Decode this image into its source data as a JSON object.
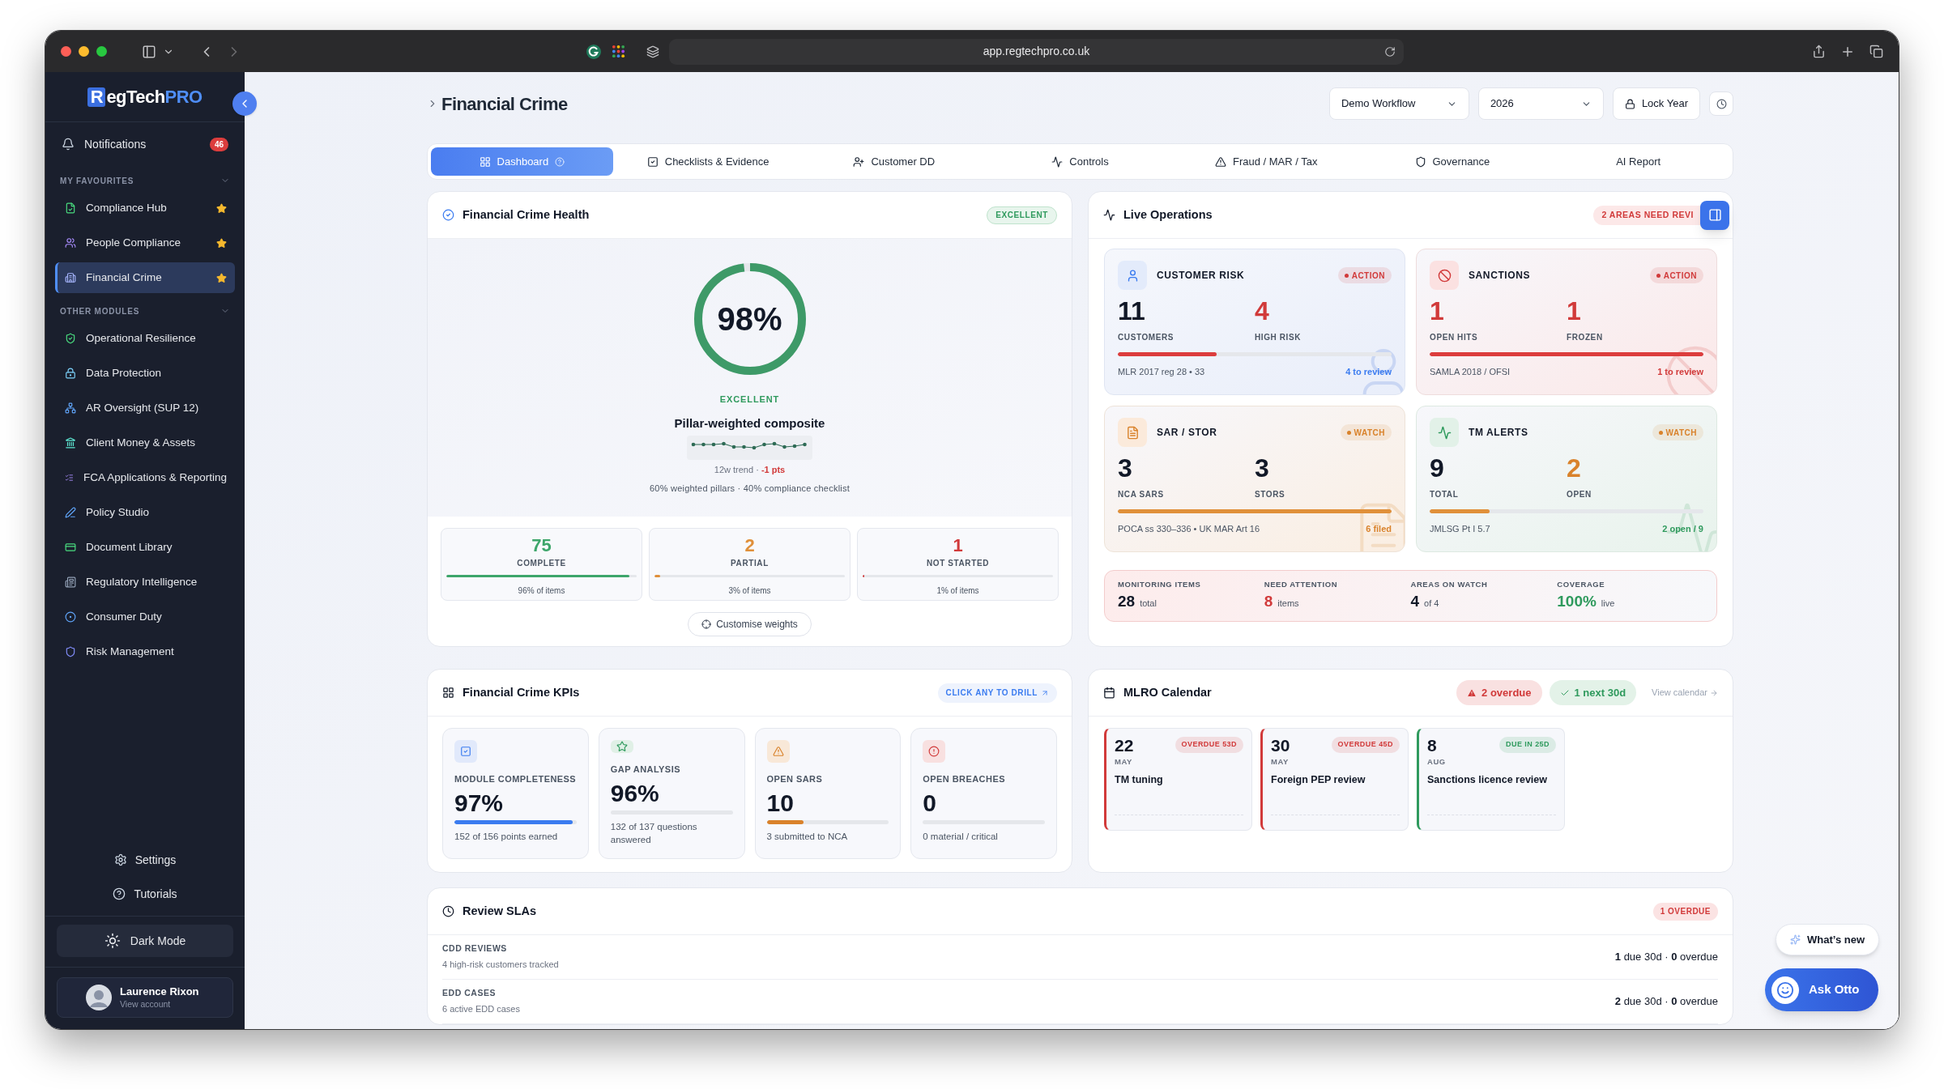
{
  "browser": {
    "url": "app.regtechpro.co.uk"
  },
  "brand": {
    "mark": "R",
    "name": "egTech",
    "accent": "PRO"
  },
  "sidebar": {
    "notifications": {
      "label": "Notifications",
      "count": "46"
    },
    "sections": [
      {
        "title": "MY FAVOURITES",
        "expanded": true,
        "items": [
          {
            "label": "Compliance Hub",
            "selected": false,
            "starred": true
          },
          {
            "label": "People Compliance",
            "selected": false,
            "starred": true
          },
          {
            "label": "Financial Crime",
            "selected": true,
            "starred": true
          }
        ]
      },
      {
        "title": "OTHER MODULES",
        "expanded": true,
        "items": [
          {
            "label": "Operational Resilience",
            "selected": false
          },
          {
            "label": "Data Protection",
            "selected": false
          },
          {
            "label": "AR Oversight (SUP 12)",
            "selected": false
          },
          {
            "label": "Client Money & Assets",
            "selected": false
          },
          {
            "label": "FCA Applications & Reporting",
            "selected": false
          },
          {
            "label": "Policy Studio",
            "selected": false
          },
          {
            "label": "Document Library",
            "selected": false
          },
          {
            "label": "Regulatory Intelligence",
            "selected": false
          },
          {
            "label": "Consumer Duty",
            "selected": false
          },
          {
            "label": "Risk Management",
            "selected": false
          }
        ]
      }
    ],
    "links": [
      {
        "label": "Settings"
      },
      {
        "label": "Tutorials"
      }
    ],
    "dark_mode": "Dark Mode",
    "account": {
      "name": "Laurence Rixon",
      "subtitle": "View account"
    }
  },
  "header": {
    "title": "Financial Crime",
    "workflow": "Demo Workflow",
    "year": "2026",
    "lock": "Lock Year"
  },
  "tabs": [
    {
      "label": "Dashboard",
      "selected": true
    },
    {
      "label": "Checklists & Evidence",
      "selected": false
    },
    {
      "label": "Customer DD",
      "selected": false
    },
    {
      "label": "Controls",
      "selected": false
    },
    {
      "label": "Fraud / MAR / Tax",
      "selected": false
    },
    {
      "label": "Governance",
      "selected": false
    },
    {
      "label": "AI Report",
      "selected": false
    }
  ],
  "health": {
    "title": "Financial Crime Health",
    "badge": "EXCELLENT",
    "score": "98%",
    "level": 0.98,
    "status": "EXCELLENT",
    "subtitle": "Pillar-weighted composite",
    "trend_label": "12w trend ·",
    "trend_delta": "-1 pts",
    "note": "60% weighted pillars · 40% compliance checklist",
    "stats": [
      {
        "value": "75",
        "label": "COMPLETE",
        "level": 0.96,
        "color": "#3ea66b",
        "caption": "96% of items"
      },
      {
        "value": "2",
        "label": "PARTIAL",
        "level": 0.03,
        "color": "#e0903a",
        "caption": "3% of items"
      },
      {
        "value": "1",
        "label": "NOT STARTED",
        "level": 0.01,
        "color": "#d13a3a",
        "caption": "1% of items"
      }
    ],
    "button": "Customise weights"
  },
  "live_operations": {
    "title": "Live Operations",
    "badge": "2 AREAS NEED REVI",
    "cards": [
      {
        "title": "CUSTOMER RISK",
        "status": {
          "label": "ACTION",
          "color": "#d13a3a"
        },
        "metrics": [
          {
            "value": "11",
            "label": "CUSTOMERS",
            "color": "#111827"
          },
          {
            "value": "4",
            "label": "HIGH RISK",
            "color": "#d13a3a"
          }
        ],
        "bar": {
          "level": 0.36,
          "color": "#dc3d3d"
        },
        "reference": "MLR 2017 reg 28 • 33",
        "link": {
          "label": "4 to review",
          "color": "#3b7cf0"
        }
      },
      {
        "title": "SANCTIONS",
        "status": {
          "label": "ACTION",
          "color": "#d13a3a"
        },
        "metrics": [
          {
            "value": "1",
            "label": "OPEN HITS",
            "color": "#d13a3a"
          },
          {
            "value": "1",
            "label": "FROZEN",
            "color": "#d13a3a"
          }
        ],
        "bar": {
          "level": 1,
          "color": "#dc3d3d"
        },
        "reference": "SAMLA 2018 / OFSI",
        "link": {
          "label": "1 to review",
          "color": "#d13a3a"
        }
      },
      {
        "title": "SAR / STOR",
        "status": {
          "label": "WATCH",
          "color": "#d9822b"
        },
        "metrics": [
          {
            "value": "3",
            "label": "NCA SARS",
            "color": "#111827"
          },
          {
            "value": "3",
            "label": "STORS",
            "color": "#111827"
          }
        ],
        "bar": {
          "level": 1,
          "color": "#e0903a"
        },
        "reference": "POCA ss 330–336 • UK MAR Art 16",
        "link": {
          "label": "6 filed",
          "color": "#d9822b"
        }
      },
      {
        "title": "TM ALERTS",
        "status": {
          "label": "WATCH",
          "color": "#d9822b"
        },
        "metrics": [
          {
            "value": "9",
            "label": "TOTAL",
            "color": "#111827"
          },
          {
            "value": "2",
            "label": "OPEN",
            "color": "#d9822b"
          }
        ],
        "bar": {
          "level": 0.22,
          "color": "#e0903a"
        },
        "reference": "JMLSG Pt I 5.7",
        "link": {
          "label": "2 open / 9",
          "color": "#2f9a5d"
        }
      }
    ],
    "summary": [
      {
        "label": "MONITORING ITEMS",
        "value": "28",
        "unit": "total",
        "color": "#111827"
      },
      {
        "label": "NEED ATTENTION",
        "value": "8",
        "unit": "items",
        "color": "#d13a3a"
      },
      {
        "label": "AREAS ON WATCH",
        "value": "4",
        "unit": "of 4",
        "color": "#111827"
      },
      {
        "label": "COVERAGE",
        "value": "100%",
        "unit": "live",
        "color": "#2f9a5d"
      }
    ]
  },
  "kpis": {
    "title": "Financial Crime KPIs",
    "drill": "CLICK ANY TO DRILL",
    "items": [
      {
        "label": "MODULE COMPLETENESS",
        "value": "97%",
        "level": 0.97,
        "color": "#3b7cf0",
        "caption": "152 of 156 points earned"
      },
      {
        "label": "GAP ANALYSIS",
        "value": "96%",
        "caption": "132 of 137 questions answered"
      },
      {
        "label": "OPEN SARS",
        "value": "10",
        "level": 0.3,
        "color": "#d9822b",
        "caption": "3 submitted to NCA"
      },
      {
        "label": "OPEN BREACHES",
        "value": "0",
        "caption": "0 material / critical"
      }
    ]
  },
  "calendar": {
    "title": "MLRO Calendar",
    "overdue": "2 overdue",
    "upcoming": "1 next 30d",
    "link": "View calendar",
    "events": [
      {
        "day": "22",
        "month": "MAY",
        "badge": "OVERDUE 53D",
        "color": "#d13a3a",
        "title": "TM tuning"
      },
      {
        "day": "30",
        "month": "MAY",
        "badge": "OVERDUE 45D",
        "color": "#d13a3a",
        "title": "Foreign PEP review"
      },
      {
        "day": "8",
        "month": "AUG",
        "badge": "DUE IN 25D",
        "color": "#2f9a5d",
        "title": "Sanctions licence review"
      }
    ]
  },
  "review_slas": {
    "title": "Review SLAs",
    "badge": "1 OVERDUE",
    "rows": [
      {
        "title": "CDD REVIEWS",
        "subtitle": "4 high-risk customers tracked",
        "summary": "**1** due 30d · **0** overdue"
      },
      {
        "title": "EDD CASES",
        "subtitle": "6 active EDD cases",
        "summary": "**2** due 30d · **0** overdue"
      }
    ]
  },
  "assistant": {
    "whats_new": "What’s new",
    "ask": "Ask Otto"
  }
}
